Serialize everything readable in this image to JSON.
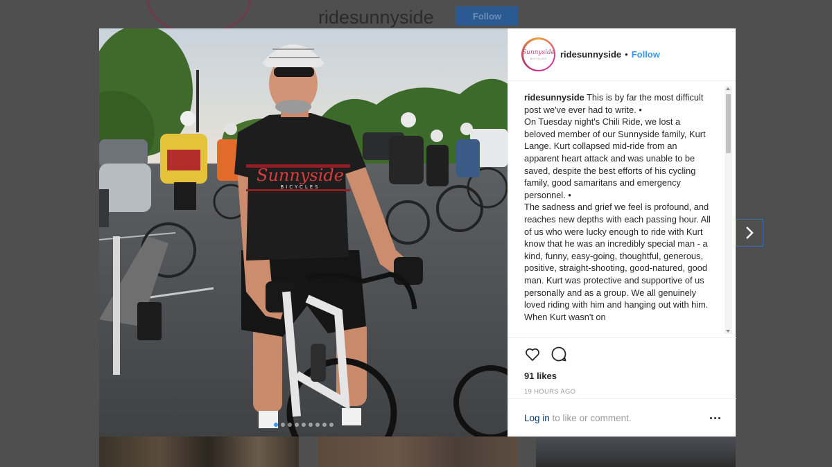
{
  "background": {
    "username": "ridesunnyside",
    "follow_label": "Follow"
  },
  "post": {
    "header": {
      "username": "ridesunnyside",
      "separator": "•",
      "follow_label": "Follow",
      "avatar_text": "Sunnyside",
      "avatar_subtext": "BICYCLES"
    },
    "photo": {
      "jersey_text": "Sunnyside",
      "jersey_subtext": "BICYCLES",
      "carousel_count": 9,
      "carousel_active": 1
    },
    "caption": {
      "username": "ridesunnyside",
      "paragraphs": [
        " This is by far the most difficult post we've ever had to write. •",
        "On Tuesday night's Chili Ride, we lost a beloved member of our Sunnyside family, Kurt Lange. Kurt collapsed mid-ride from an apparent heart attack and was unable to be saved, despite the best efforts of his cycling family, good samaritans and emergency personnel. •",
        "The sadness and grief we feel is profound, and reaches new depths with each passing hour. All of us who were lucky enough to ride with Kurt know that he was an incredibly special man - a kind, funny, easy-going, thoughtful, generous, positive, straight-shooting, good-natured, good man. Kurt was protective and supportive of us personally and as a group. We all genuinely loved riding with him and hanging out with him. When Kurt wasn't on"
      ]
    },
    "likes": "91 likes",
    "time": "19 HOURS AGO",
    "comment": {
      "login_label": "Log in",
      "rest": " to like or comment."
    }
  },
  "colors": {
    "link_blue": "#3897f0",
    "accent_ring": "#d6249f"
  },
  "icons": [
    "heart-icon",
    "comment-icon",
    "more-icon",
    "chevron-right-icon"
  ]
}
